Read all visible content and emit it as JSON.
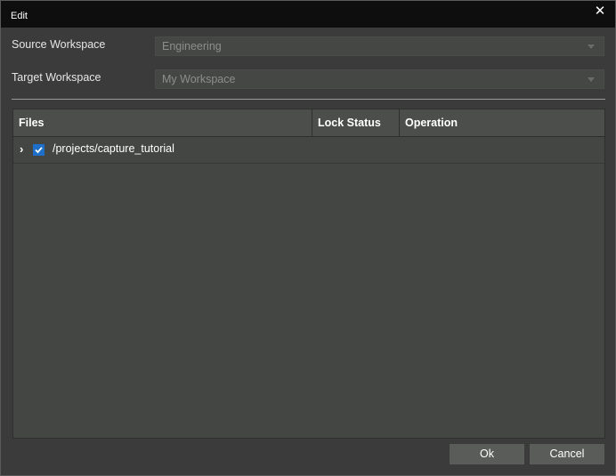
{
  "window": {
    "title": "Edit",
    "close_glyph": "✕",
    "close_icon": "close-icon"
  },
  "form": {
    "source": {
      "label": "Source Workspace",
      "value": "Engineering"
    },
    "target": {
      "label": "Target Workspace",
      "value": "My Workspace"
    }
  },
  "grid": {
    "columns": [
      "Files",
      "Lock Status",
      "Operation"
    ],
    "rows": [
      {
        "expander_glyph": "›",
        "checked": true,
        "path": "/projects/capture_tutorial",
        "lock_status": "",
        "operation": ""
      }
    ]
  },
  "buttons": {
    "ok": "Ok",
    "cancel": "Cancel"
  },
  "colors": {
    "titlebar": "#0e0e0e",
    "background": "#3a3b3a",
    "checkbox_accent": "#1d6fc9",
    "button": "#5a5c5a"
  }
}
